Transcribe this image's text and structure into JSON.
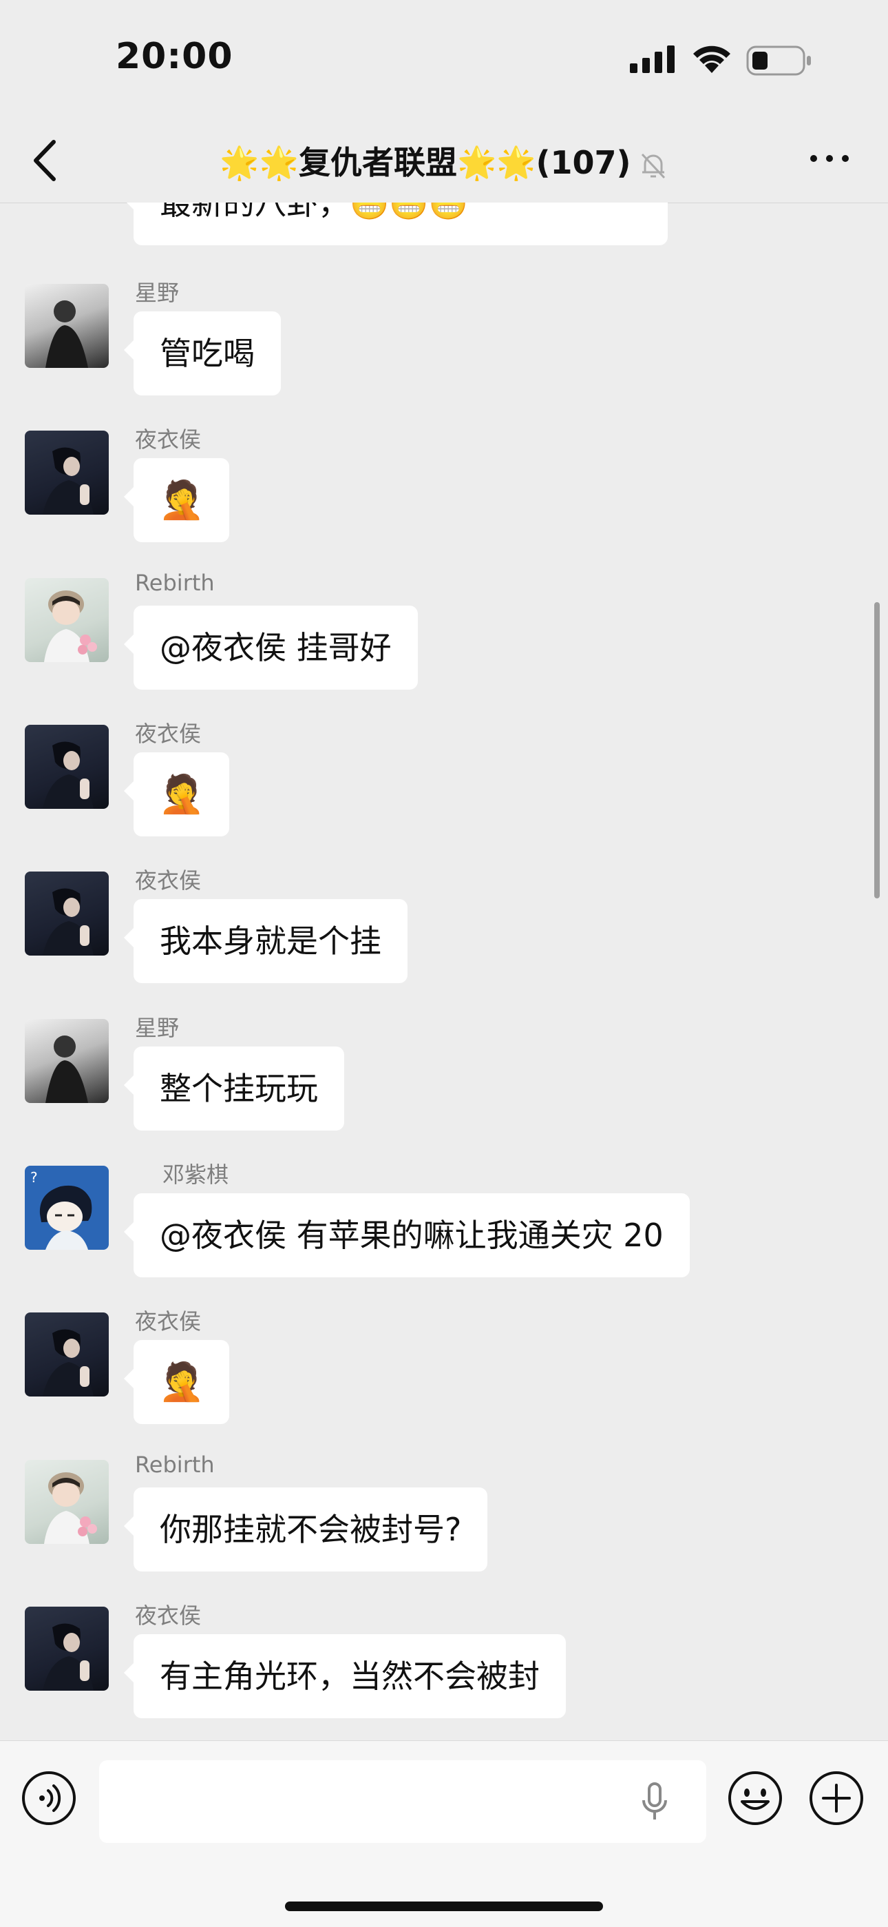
{
  "status_bar": {
    "time": "20:00"
  },
  "header": {
    "title": "🌟🌟复仇者联盟🌟🌟(107)"
  },
  "messages": [
    {
      "sender": "",
      "text": "最新的八卦，😬😬😬"
    },
    {
      "sender": "星野",
      "text": "管吃喝"
    },
    {
      "sender": "夜衣侯",
      "text": "🤦"
    },
    {
      "sender": "Rebirth",
      "text": "@夜衣侯 挂哥好"
    },
    {
      "sender": "夜衣侯",
      "text": "🤦"
    },
    {
      "sender": "夜衣侯",
      "text": "我本身就是个挂"
    },
    {
      "sender": "星野",
      "text": "整个挂玩玩"
    },
    {
      "sender": "邓紫棋",
      "text": "@夜衣侯 有苹果的嘛让我通关灾 20"
    },
    {
      "sender": "夜衣侯",
      "text": "🤦"
    },
    {
      "sender": "Rebirth",
      "text": "你那挂就不会被封号?"
    },
    {
      "sender": "夜衣侯",
      "text": "有主角光环，当然不会被封"
    }
  ],
  "input": {
    "value": ""
  },
  "icons": {
    "back": "chevron-left-icon",
    "more": "more-icon",
    "mute": "bell-off-icon",
    "voice": "voice-icon",
    "mic": "microphone-icon",
    "sticker": "emoji-icon",
    "plus": "plus-icon"
  }
}
